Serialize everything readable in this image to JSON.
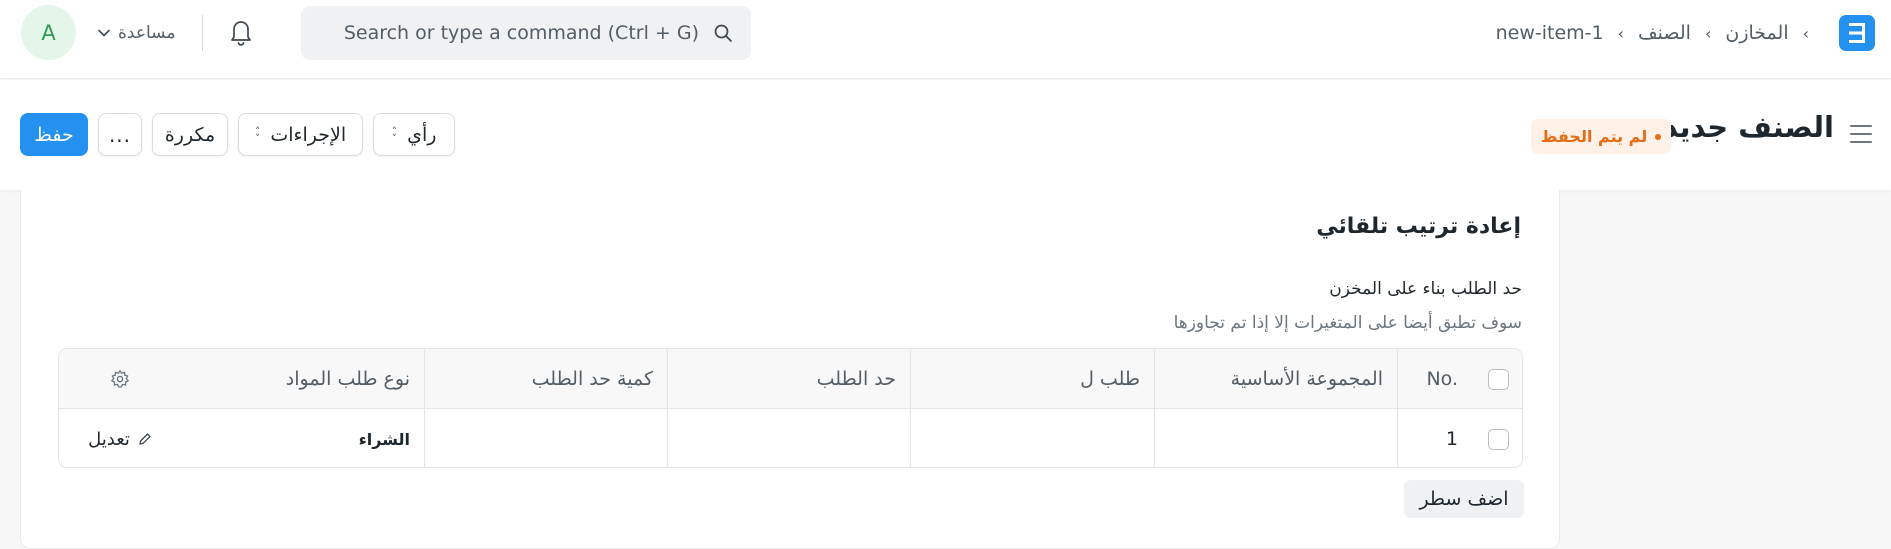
{
  "navbar": {
    "logo_letter": "E",
    "breadcrumbs": [
      "المخازن",
      "الصنف",
      "new-item-1"
    ],
    "search_placeholder": "Search or type a command (Ctrl + G)",
    "help_label": "مساعدة",
    "avatar_initial": "A",
    "icons": [
      "logo-icon",
      "search-icon",
      "bell-icon",
      "chevron-down-icon"
    ]
  },
  "page_head": {
    "title": "الصنف جديد",
    "status": "لم يتم الحفظ",
    "buttons": {
      "save": "حفظ",
      "more": "...",
      "duplicate": "مكررة",
      "actions": "الإجراءات",
      "view": "رأي"
    }
  },
  "section": {
    "title": "إعادة ترتيب تلقائي",
    "field_label": "حد الطلب بناء على المخزن",
    "field_description": "سوف تطبق أيضا على المتغيرات إلا إذا تم تجاوزها"
  },
  "table": {
    "columns": [
      "No.",
      "المجموعة الأساسية",
      "طلب ل",
      "حد الطلب",
      "كمية حد الطلب",
      "نوع طلب المواد"
    ],
    "rows": [
      {
        "no": "1",
        "warehouse_group": "",
        "request_for": "",
        "reorder_level": "",
        "reorder_qty": "",
        "material_request_type": "الشراء"
      }
    ],
    "edit_label": "تعديل",
    "add_row_label": "اضف سطر"
  },
  "colors": {
    "primary": "#2490ef",
    "status_text": "#e86c13",
    "status_bg": "#fff1e7",
    "avatar_bg": "#e4f5e9",
    "avatar_text": "#2e9b52"
  }
}
